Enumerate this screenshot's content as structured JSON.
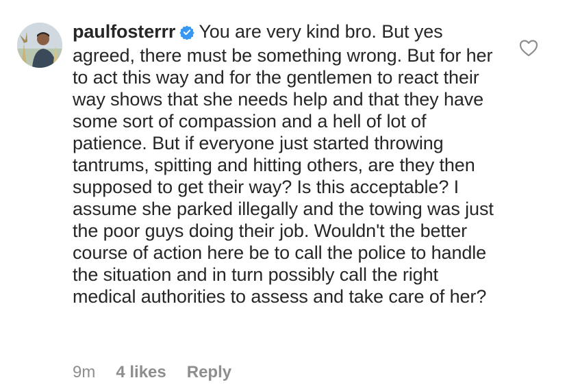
{
  "comment": {
    "username": "paulfosterrr",
    "text": "You are very kind bro. But yes agreed, there must be something wrong. But for her to act this way and for the gentlemen to react their way shows that she needs help and that they have some sort of compassion and a hell of lot of patience. But if everyone just started throwing tantrums, spitting and hitting others, are they then supposed to get their way? Is this acceptable? I assume she parked illegally and the towing was just the poor guys doing their job. Wouldn't the better course of action here be to call the police to handle the situation and in turn possibly call the right medical authorities to assess and take care of her?",
    "verified_icon": "verified-badge-icon",
    "like_icon": "heart-outline-icon"
  },
  "meta": {
    "time": "9m",
    "likes": "4 likes",
    "reply": "Reply"
  },
  "colors": {
    "text": "#262626",
    "muted": "#8e8e8e",
    "verified": "#3897f0"
  }
}
